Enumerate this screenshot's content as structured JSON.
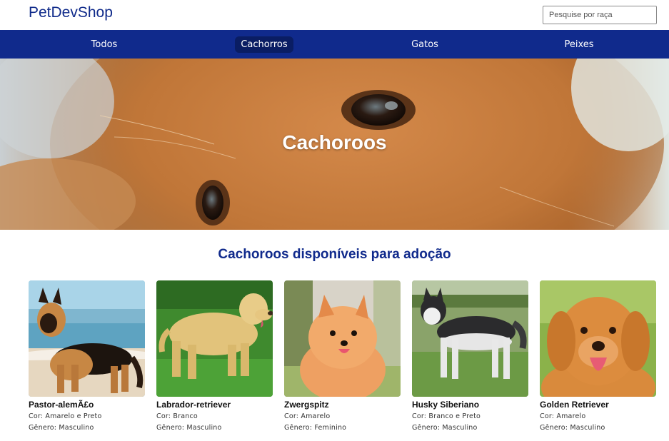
{
  "header": {
    "brand": "PetDevShop",
    "search_placeholder": "Pesquise por raça"
  },
  "nav": {
    "items": [
      {
        "label": "Todos",
        "active": false
      },
      {
        "label": "Cachorros",
        "active": true
      },
      {
        "label": "Gatos",
        "active": false
      },
      {
        "label": "Peixes",
        "active": false
      }
    ]
  },
  "hero": {
    "title": "Cachoroos"
  },
  "section": {
    "title": "Cachoroos disponíveis para adoção"
  },
  "pets": [
    {
      "name": "Pastor-alemÃ£o",
      "color": "Cor: Amarelo e Preto",
      "gender": "Gênero: Masculino"
    },
    {
      "name": "Labrador-retriever",
      "color": "Cor: Branco",
      "gender": "Gênero: Masculino"
    },
    {
      "name": "Zwergspitz",
      "color": "Cor: Amarelo",
      "gender": "Gênero: Feminino"
    },
    {
      "name": "Husky Siberiano",
      "color": "Cor: Branco e Preto",
      "gender": "Gênero: Masculino"
    },
    {
      "name": "Golden Retriever",
      "color": "Cor: Amarelo",
      "gender": "Gênero: Masculino"
    }
  ],
  "colors": {
    "brand": "#0f2a8a",
    "nav_bg": "#102a8c",
    "nav_active": "#0a1d63"
  }
}
